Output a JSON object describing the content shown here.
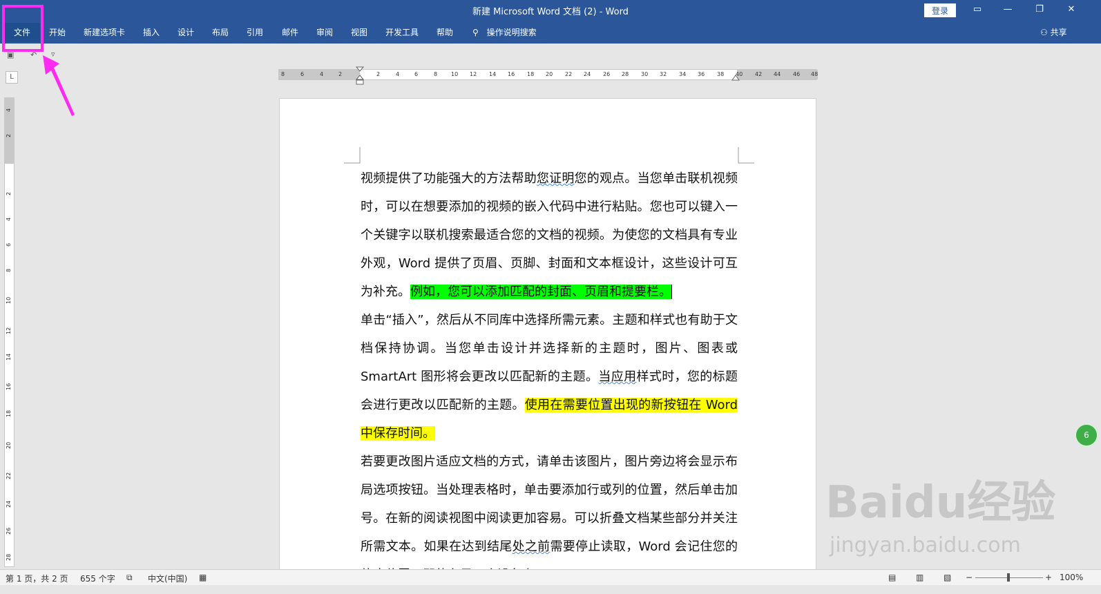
{
  "window": {
    "title": "新建 Microsoft Word 文档 (2)  -  Word",
    "login_label": "登录",
    "controls": [
      "ribbon-display-icon",
      "minimize-icon",
      "restore-icon",
      "close-icon"
    ]
  },
  "ribbon": {
    "tabs": [
      "文件",
      "开始",
      "新建选项卡",
      "插入",
      "设计",
      "布局",
      "引用",
      "邮件",
      "审阅",
      "视图",
      "开发工具",
      "帮助"
    ],
    "active_tab": "文件",
    "tell_me": "操作说明搜索",
    "share": "共享"
  },
  "ruler": {
    "horizontal_ticks": [
      "8",
      "6",
      "4",
      "2",
      "2",
      "4",
      "6",
      "8",
      "10",
      "12",
      "14",
      "16",
      "18",
      "20",
      "22",
      "24",
      "26",
      "28",
      "30",
      "32",
      "34",
      "36",
      "38",
      "40",
      "42",
      "44",
      "46",
      "48"
    ],
    "vertical_ticks": [
      "4",
      "2",
      "2",
      "4",
      "6",
      "8",
      "10",
      "12",
      "14",
      "16",
      "18",
      "20",
      "22",
      "24",
      "26",
      "28"
    ]
  },
  "document": {
    "paragraphs": [
      {
        "segments": [
          {
            "text": "视频提供了功能强大的方法帮助"
          },
          {
            "text": "您证明",
            "style": "squig"
          },
          {
            "text": "您的观点。当您单击联机视频时，可以在想要添加的视频的嵌入代码中进行粘贴。您也可以键入一个关键字以联机搜索最适合您的文档的视频。为使您的文档具有专业外观，Word 提供了页眉、页脚、封面和文本框设计，这些设计可互为补充。"
          },
          {
            "text": "例如，您可以添加匹配的封面、页眉和提要栏。",
            "style": "hl-green"
          }
        ]
      },
      {
        "segments": [
          {
            "text": "单击“插入”，然后从不同库中选择所需元素。主题和样式也有助于文档保持协调。当您单击设计并选择新的主题时，图片、图表或 SmartArt 图形将会更改以匹配新的主题。"
          },
          {
            "text": "当应用",
            "style": "squig"
          },
          {
            "text": "样式时，您的标题会进行更改以匹配新的主题。"
          },
          {
            "text": "使用在需要位置出现的新按钮在 Word 中保存时间。",
            "style": "hl-yellow"
          }
        ]
      },
      {
        "segments": [
          {
            "text": "若要更改图片适应文档的方式，请单击该图片，图片旁边将会显示布局选项按钮。当处理表格时，单击要添加行或列的位置，然后单击加号。在新的阅读视图中阅读更加容易。可以折叠文档某些部分并关注所需文本。如果在达到结尾"
          },
          {
            "text": "处之前",
            "style": "squig"
          },
          {
            "text": "需要停止读取，Word 会记住您的停止位置 - 即使在另一个设备上。"
          }
        ]
      }
    ]
  },
  "status": {
    "page": "第 1 页，共 2 页",
    "words": "655 个字",
    "language": "中文(中国)",
    "zoom": "100%"
  },
  "watermark": {
    "logo": "Baidu经验",
    "url": "jingyan.baidu.com"
  },
  "side_badge": "6"
}
